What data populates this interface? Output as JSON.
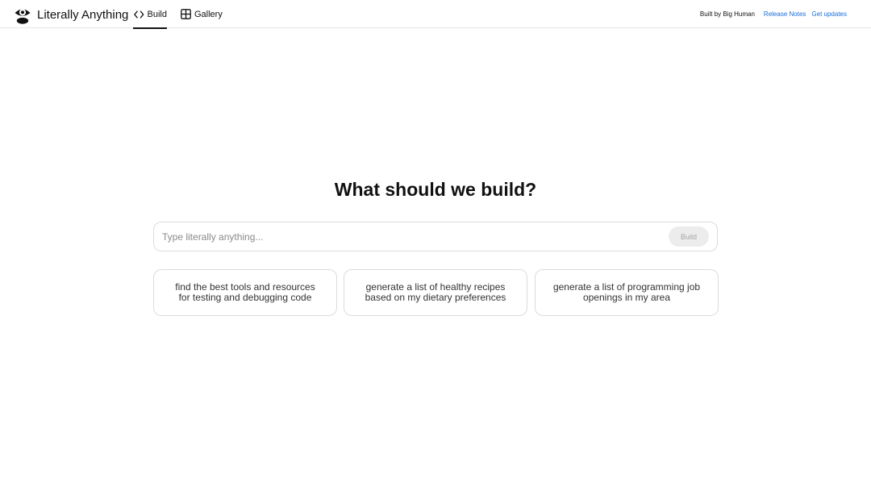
{
  "header": {
    "brand_name": "Literally Anything",
    "logo_icon": "eye-icon",
    "tabs": [
      {
        "label": "Build",
        "icon": "code-brackets-icon",
        "active": true
      },
      {
        "label": "Gallery",
        "icon": "grid-icon",
        "active": false
      }
    ],
    "built_by": "Built by Big Human",
    "links": [
      {
        "label": "Release Notes"
      },
      {
        "label": "Get updates"
      }
    ]
  },
  "main": {
    "headline": "What should we build?",
    "prompt": {
      "value": "",
      "placeholder": "Type literally anything...",
      "button_label": "Build"
    },
    "suggestions": [
      {
        "text": "find the best tools and resources for testing and debugging code"
      },
      {
        "text": "generate a list of healthy recipes based on my dietary preferences"
      },
      {
        "text": "generate a list of programming job openings in my area"
      }
    ]
  },
  "colors": {
    "text": "#111111",
    "link": "#1a6fd8",
    "border": "#dcdcdc",
    "button_bg": "#ececec",
    "button_text": "#a5a5a5",
    "placeholder": "#8a8a8a"
  }
}
